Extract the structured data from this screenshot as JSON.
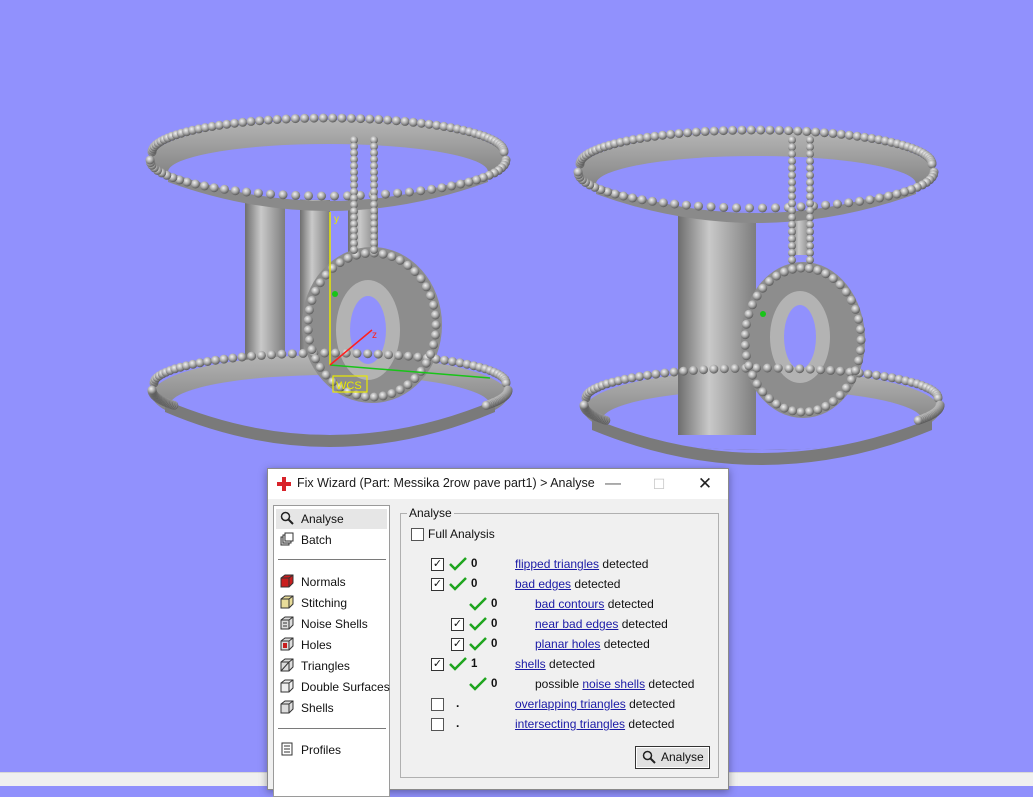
{
  "dialog": {
    "title": "Fix Wizard (Part: Messika 2row pave part1) > Analyse",
    "min_glyph": "—",
    "max_glyph": "☐",
    "close_glyph": "✕"
  },
  "viewport": {
    "background": "#9191fd",
    "wcs_label": "WCS",
    "axis_y": "y",
    "axis_z": "z"
  },
  "nav": {
    "items": [
      {
        "label": "Analyse",
        "icon": "magnifier-icon"
      },
      {
        "label": "Batch",
        "icon": "batch-icon"
      },
      {
        "label": "Normals",
        "icon": "normals-cube-icon"
      },
      {
        "label": "Stitching",
        "icon": "stitching-cube-icon"
      },
      {
        "label": "Noise Shells",
        "icon": "noise-shells-icon"
      },
      {
        "label": "Holes",
        "icon": "holes-cube-icon"
      },
      {
        "label": "Triangles",
        "icon": "triangles-cube-icon"
      },
      {
        "label": "Double Surfaces",
        "icon": "double-surfaces-icon"
      },
      {
        "label": "Shells",
        "icon": "shells-cube-icon"
      },
      {
        "label": "Profiles",
        "icon": "profiles-icon"
      }
    ]
  },
  "analyse": {
    "group_title": "Analyse",
    "full_analysis": "Full Analysis",
    "detected": "detected",
    "possible": "possible",
    "rows": [
      {
        "link": "flipped triangles",
        "count": "0"
      },
      {
        "link": "bad edges",
        "count": "0"
      },
      {
        "link": "bad contours",
        "count": "0"
      },
      {
        "link": "near bad edges",
        "count": "0"
      },
      {
        "link": "planar holes",
        "count": "0"
      },
      {
        "link": "shells",
        "count": "1"
      },
      {
        "link": "noise shells",
        "count": "0"
      },
      {
        "link": "overlapping triangles",
        "count": "."
      },
      {
        "link": "intersecting triangles",
        "count": "."
      }
    ],
    "button_label": "Analyse",
    "check_color": "#1fa51f",
    "link_color": "#1a1aa6"
  }
}
